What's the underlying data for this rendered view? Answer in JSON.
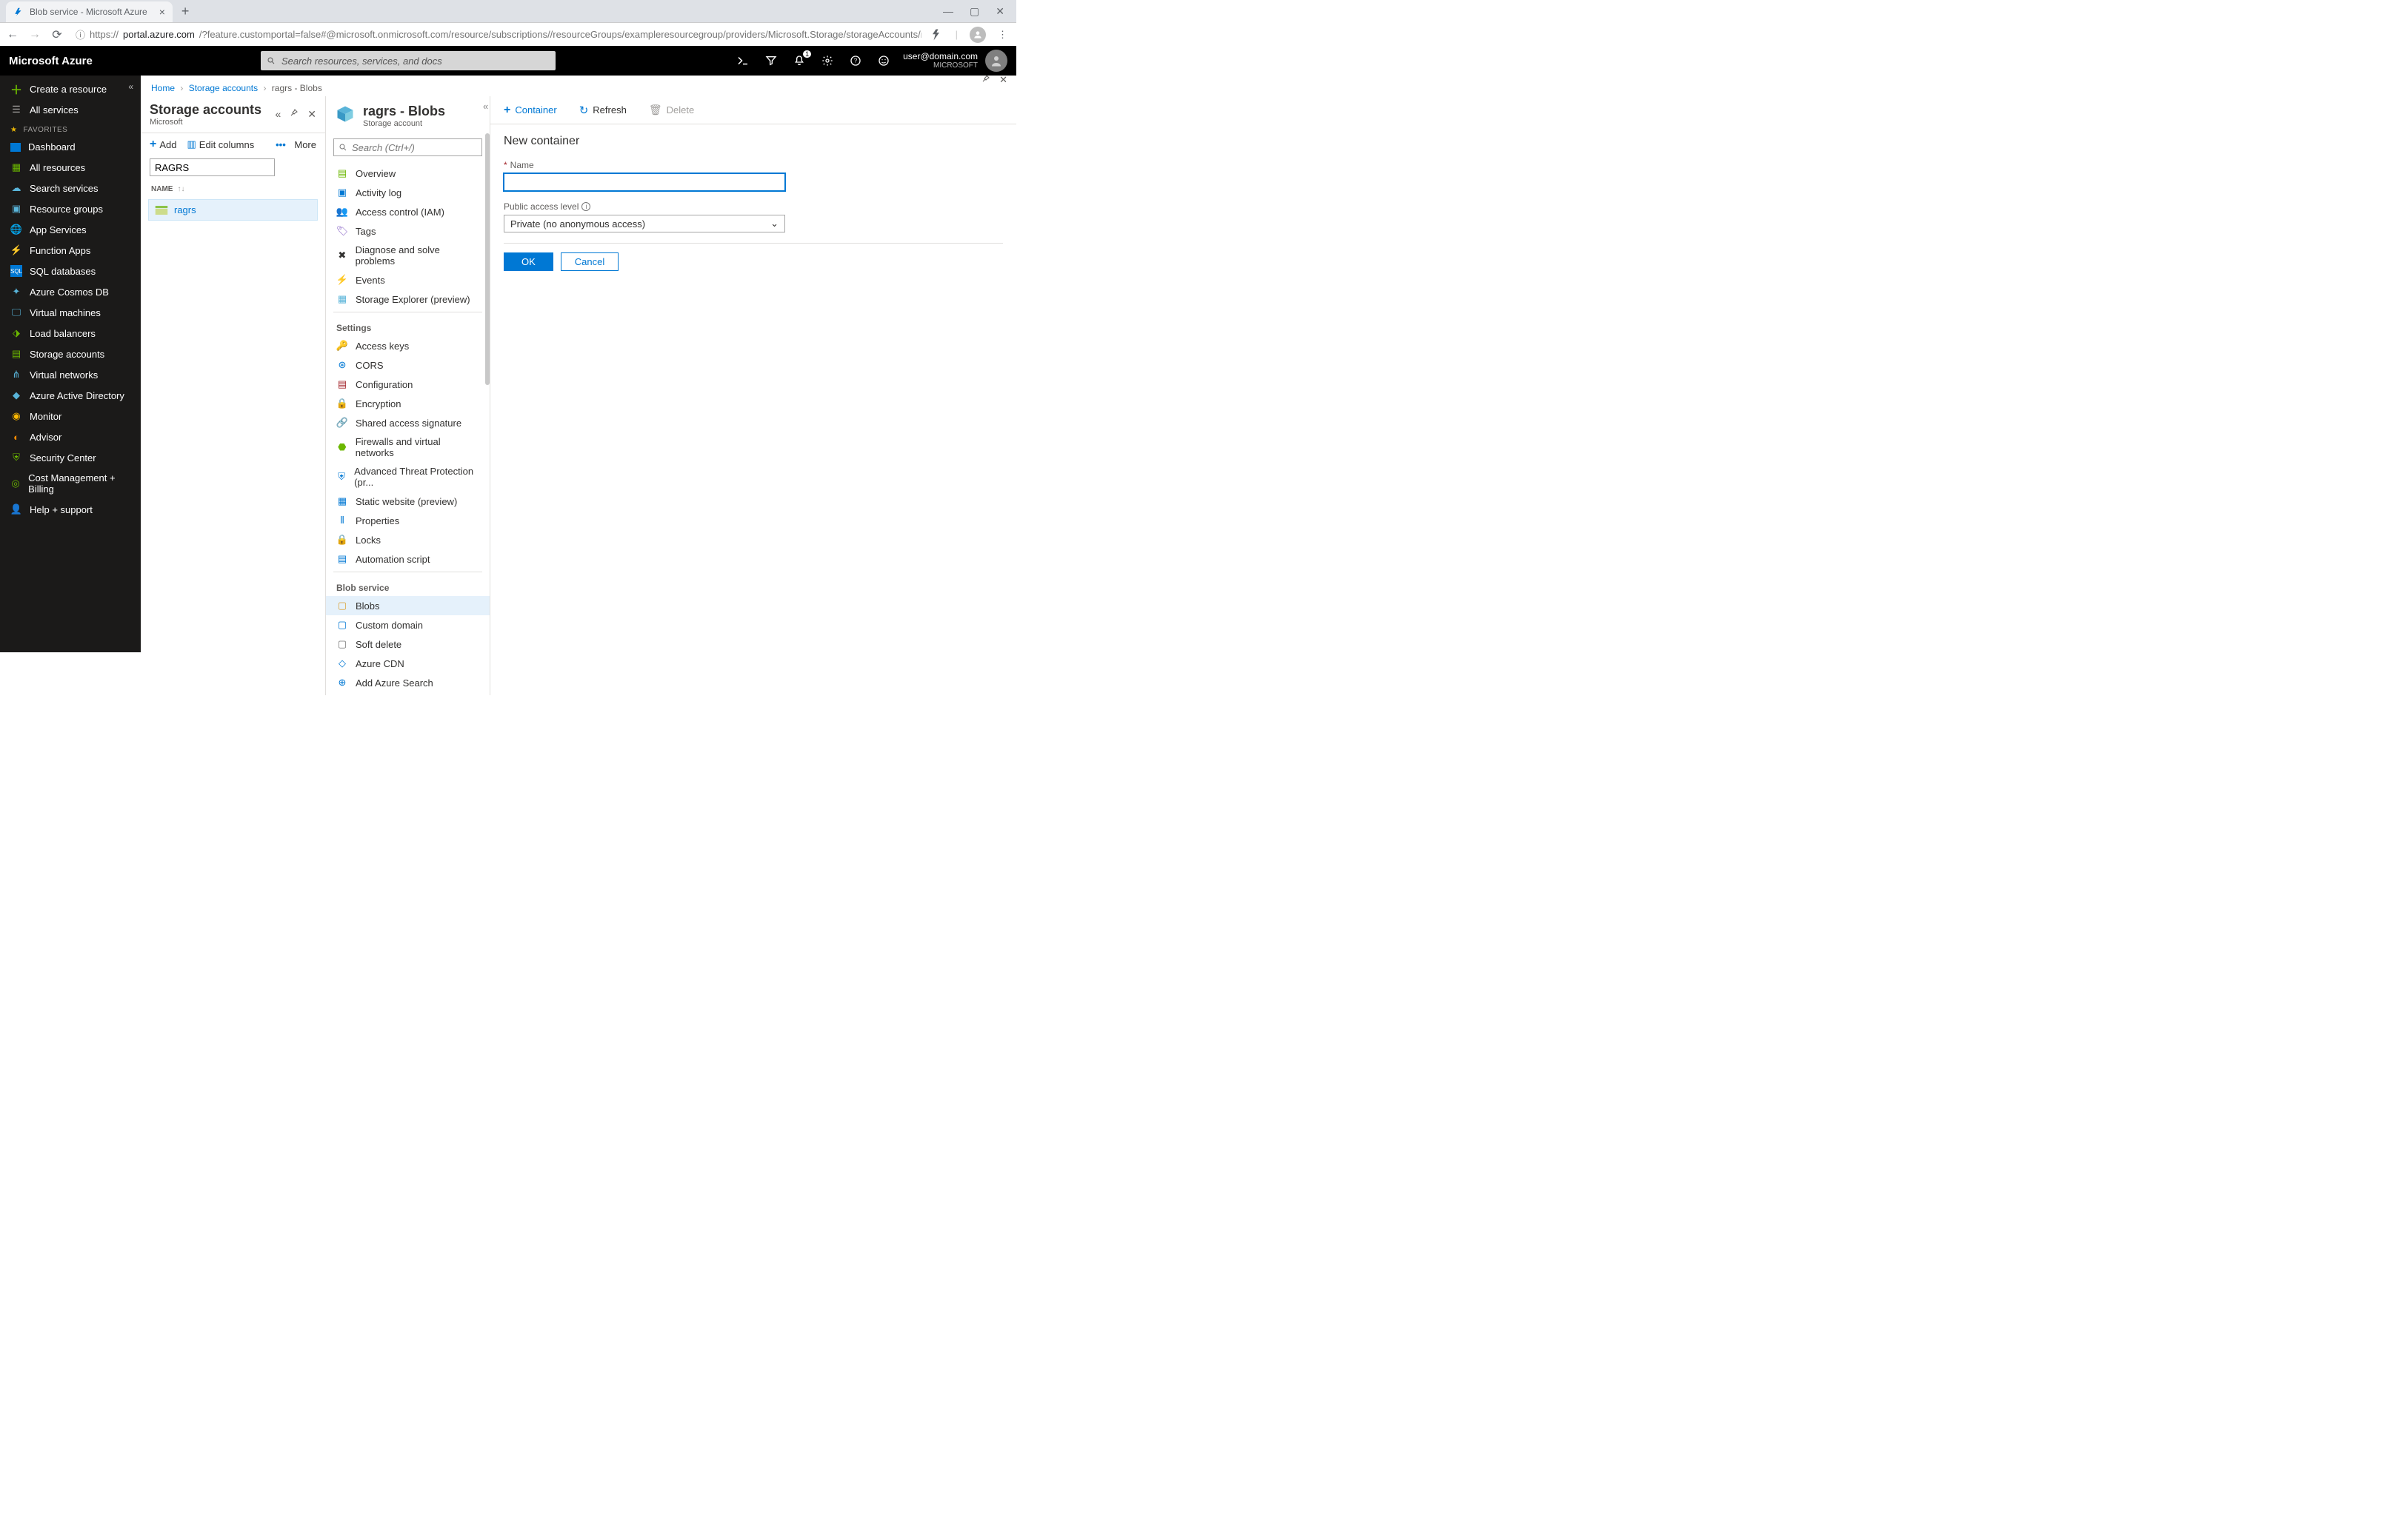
{
  "browser": {
    "tab_title": "Blob service - Microsoft Azure",
    "url_prefix": "https://",
    "url_host": "portal.azure.com",
    "url_path": "/?feature.customportal=false#@microsoft.onmicrosoft.com/resource/subscriptions//resourceGroups/exampleresourcegroup/providers/Microsoft.Storage/storageAccounts/ragrs/containersList"
  },
  "azure_header": {
    "brand": "Microsoft Azure",
    "search_placeholder": "Search resources, services, and docs",
    "notification_count": "1",
    "user_email": "user@domain.com",
    "user_tenant": "MICROSOFT"
  },
  "left_nav": {
    "create": "Create a resource",
    "all_services": "All services",
    "favorites_header": "FAVORITES",
    "items": [
      {
        "label": "Dashboard"
      },
      {
        "label": "All resources"
      },
      {
        "label": "Search services"
      },
      {
        "label": "Resource groups"
      },
      {
        "label": "App Services"
      },
      {
        "label": "Function Apps"
      },
      {
        "label": "SQL databases"
      },
      {
        "label": "Azure Cosmos DB"
      },
      {
        "label": "Virtual machines"
      },
      {
        "label": "Load balancers"
      },
      {
        "label": "Storage accounts"
      },
      {
        "label": "Virtual networks"
      },
      {
        "label": "Azure Active Directory"
      },
      {
        "label": "Monitor"
      },
      {
        "label": "Advisor"
      },
      {
        "label": "Security Center"
      },
      {
        "label": "Cost Management + Billing"
      },
      {
        "label": "Help + support"
      }
    ]
  },
  "breadcrumb": {
    "home": "Home",
    "storage_accounts": "Storage accounts",
    "current": "ragrs - Blobs"
  },
  "storage_col": {
    "title": "Storage accounts",
    "subtitle": "Microsoft",
    "add": "Add",
    "edit_columns": "Edit columns",
    "more": "More",
    "filter_value": "RAGRS",
    "column_name": "NAME",
    "rows": [
      {
        "label": "ragrs"
      }
    ]
  },
  "resource_col": {
    "title": "ragrs - Blobs",
    "subtitle": "Storage account",
    "search_placeholder": "Search (Ctrl+/)",
    "sections": {
      "top": [
        {
          "label": "Overview",
          "icon": "#59b4d9"
        },
        {
          "label": "Activity log",
          "icon": "#0078d4"
        },
        {
          "label": "Access control (IAM)",
          "icon": "#0078d4"
        },
        {
          "label": "Tags",
          "icon": "#8661c5"
        },
        {
          "label": "Diagnose and solve problems",
          "icon": "#323130"
        },
        {
          "label": "Events",
          "icon": "#ffb900"
        },
        {
          "label": "Storage Explorer (preview)",
          "icon": "#59b4d9"
        }
      ],
      "settings_header": "Settings",
      "settings": [
        {
          "label": "Access keys",
          "icon": "#ffb900"
        },
        {
          "label": "CORS",
          "icon": "#0078d4"
        },
        {
          "label": "Configuration",
          "icon": "#a4262c"
        },
        {
          "label": "Encryption",
          "icon": "#0078d4"
        },
        {
          "label": "Shared access signature",
          "icon": "#0078d4"
        },
        {
          "label": "Firewalls and virtual networks",
          "icon": "#6bb700"
        },
        {
          "label": "Advanced Threat Protection (pr...",
          "icon": "#0078d4"
        },
        {
          "label": "Static website (preview)",
          "icon": "#0078d4"
        },
        {
          "label": "Properties",
          "icon": "#0078d4"
        },
        {
          "label": "Locks",
          "icon": "#323130"
        },
        {
          "label": "Automation script",
          "icon": "#0078d4"
        }
      ],
      "blob_header": "Blob service",
      "blob": [
        {
          "label": "Blobs",
          "icon": "#dba339"
        },
        {
          "label": "Custom domain",
          "icon": "#0078d4"
        },
        {
          "label": "Soft delete",
          "icon": "#767676"
        },
        {
          "label": "Azure CDN",
          "icon": "#0078d4"
        },
        {
          "label": "Add Azure Search",
          "icon": "#0078d4"
        }
      ]
    }
  },
  "main": {
    "container_btn": "Container",
    "refresh_btn": "Refresh",
    "delete_btn": "Delete",
    "pane_title": "New container",
    "name_label": "Name",
    "access_label": "Public access level",
    "access_value": "Private (no anonymous access)",
    "ok": "OK",
    "cancel": "Cancel"
  }
}
